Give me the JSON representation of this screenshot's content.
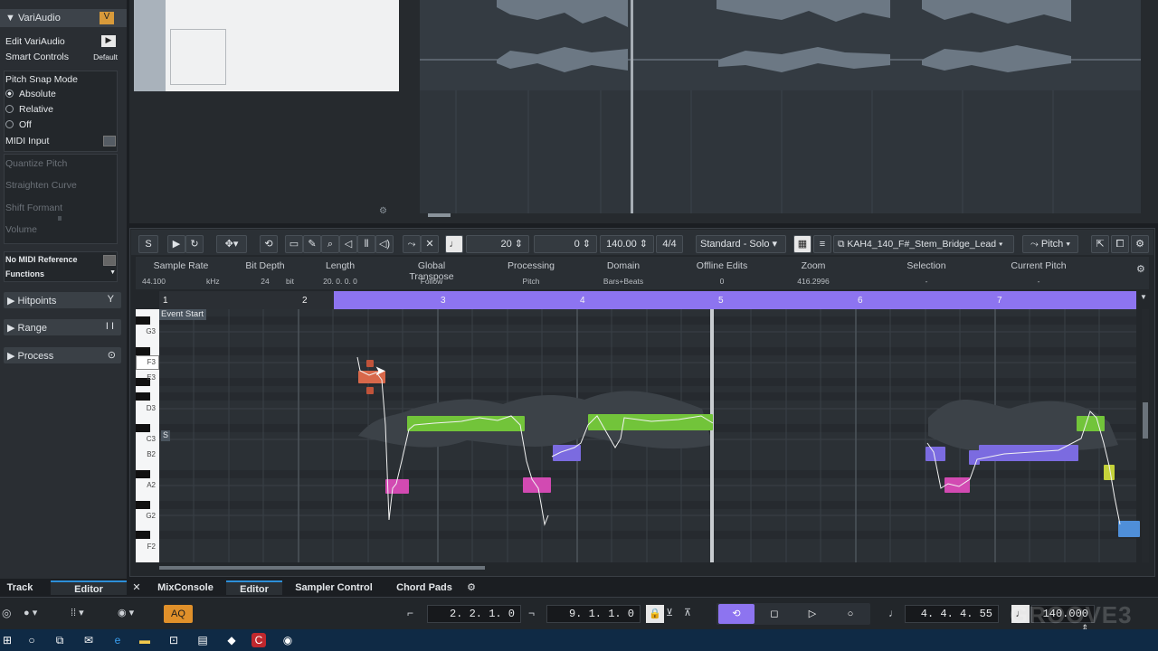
{
  "inspector": {
    "section_title": "VariAudio",
    "edit_variaudio": "Edit VariAudio",
    "smart_controls": "Smart Controls",
    "smart_controls_value": "Default",
    "pitch_snap_mode": "Pitch Snap Mode",
    "snap_options": [
      "Absolute",
      "Relative",
      "Off"
    ],
    "midi_input": "MIDI Input",
    "disabled_items": [
      "Quantize Pitch",
      "Straighten Curve",
      "Shift Formant",
      "Volume"
    ],
    "midi_reference": "No MIDI Reference",
    "functions": "Functions",
    "collapsed": [
      "Hitpoints",
      "Range",
      "Process"
    ]
  },
  "toolbar": {
    "quantize": "20",
    "offset": "0",
    "tempo": "140.00",
    "signature": "4/4",
    "mode": "Standard - Solo",
    "event_name": "KAH4_140_F#_Stem_Bridge_Lead",
    "pitch": "Pitch"
  },
  "info_line": [
    {
      "label": "Sample Rate",
      "value": "44.100",
      "unit": "kHz"
    },
    {
      "label": "Bit Depth",
      "value": "24",
      "unit": "bit"
    },
    {
      "label": "Length",
      "value": "20. 0. 0. 0",
      "unit": ""
    },
    {
      "label": "Global Transpose",
      "value": "Follow",
      "unit": ""
    },
    {
      "label": "Processing",
      "value": "Pitch",
      "unit": ""
    },
    {
      "label": "Domain",
      "value": "Bars+Beats",
      "unit": ""
    },
    {
      "label": "Offline Edits",
      "value": "0",
      "unit": ""
    },
    {
      "label": "Zoom",
      "value": "416.2996",
      "unit": ""
    },
    {
      "label": "Selection",
      "value": "-",
      "unit": ""
    },
    {
      "label": "Current Pitch",
      "value": "-",
      "unit": ""
    }
  ],
  "ruler": [
    "1",
    "2",
    "3",
    "4",
    "5",
    "6",
    "7"
  ],
  "event_start": "Event Start",
  "keys": [
    "G3",
    "F3",
    "E3",
    "D3",
    "C3",
    "B2",
    "A2",
    "G2",
    "F2"
  ],
  "s_marker": "S",
  "bottom_tabs": {
    "left": [
      "Track",
      "Editor"
    ],
    "right": [
      "MixConsole",
      "Editor",
      "Sampler Control",
      "Chord Pads"
    ]
  },
  "transport": {
    "aq": "AQ",
    "left_locator": "2. 2. 1.   0",
    "right_locator": "9. 1. 1.   0",
    "position": "4. 4. 4. 55",
    "tempo": "140.000",
    "watermark": "GROOVE3"
  },
  "colors": {
    "green": "#72c43a",
    "pink": "#d24ab2",
    "purple": "#7b6be0",
    "orange": "#d8684a",
    "ruler_bar": "#8d74f0",
    "yellow": "#c4d23a",
    "blue": "#4f8fd9"
  }
}
